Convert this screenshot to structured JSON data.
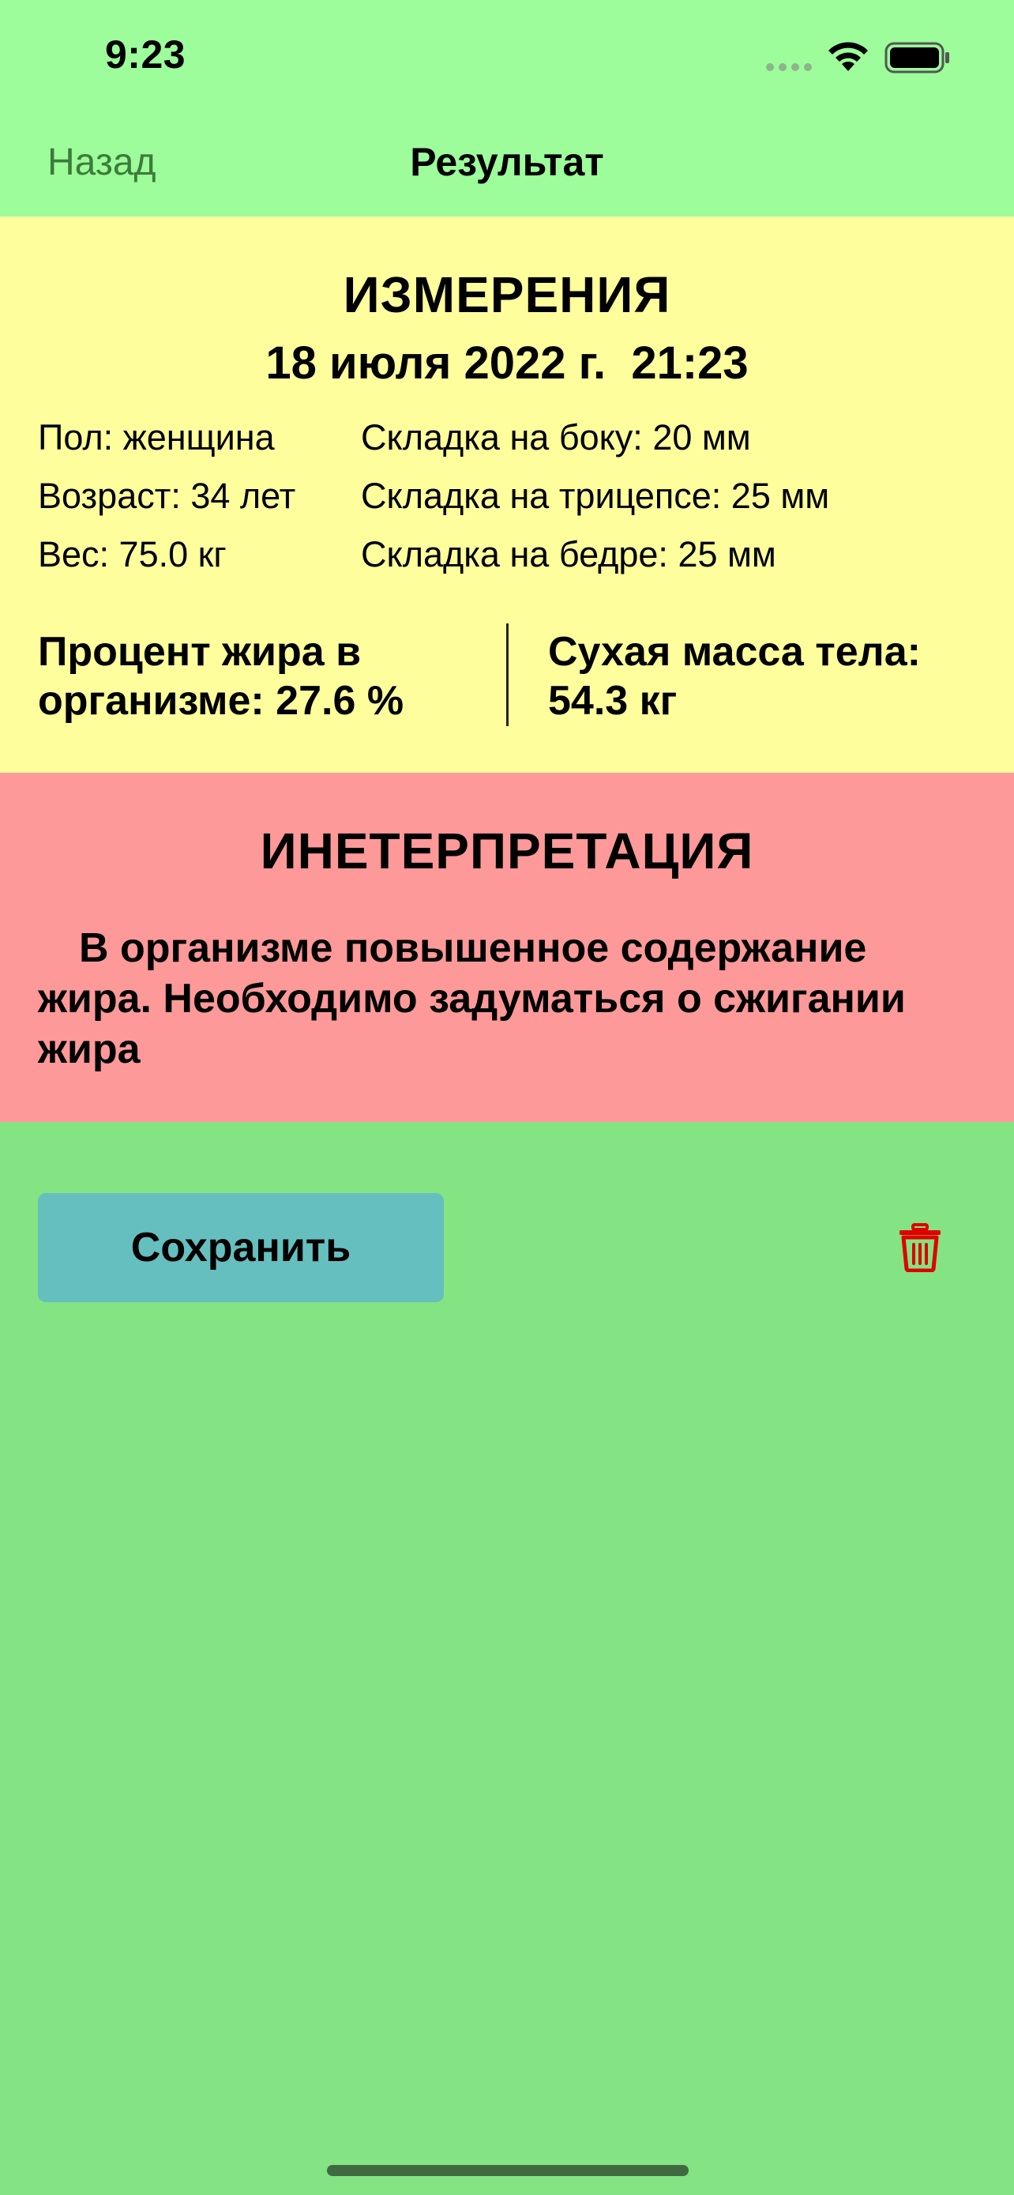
{
  "status_bar": {
    "time": "9:23"
  },
  "nav": {
    "back_label": "Назад",
    "title": "Результат"
  },
  "measurements": {
    "title": "ИЗМЕРЕНИЯ",
    "datetime": "18 июля 2022 г.  21:23",
    "left_column": [
      "Пол: женщина",
      "Возраст: 34 лет",
      "Вес: 75.0 кг"
    ],
    "right_column": [
      "Складка на боку: 20 мм",
      "Складка на трицепсе: 25 мм",
      "Складка на бедре: 25 мм"
    ],
    "body_fat": "Процент жира в организме: 27.6 %",
    "lean_mass": "Сухая масса тела: 54.3 кг"
  },
  "interpretation": {
    "title": "ИНЕТЕРПРЕТАЦИЯ",
    "text": "В организме повышенное содержание жира. Необходимо задуматься о сжигании жира"
  },
  "actions": {
    "save_label": "Сохранить",
    "delete_icon": "trash-icon"
  },
  "colors": {
    "header_bg": "#9dfd9b",
    "measurements_bg": "#fefe9c",
    "interpretation_bg": "#fe9999",
    "page_bg": "#84e383",
    "save_button_bg": "#66bfbf",
    "trash_color": "#e00000"
  }
}
